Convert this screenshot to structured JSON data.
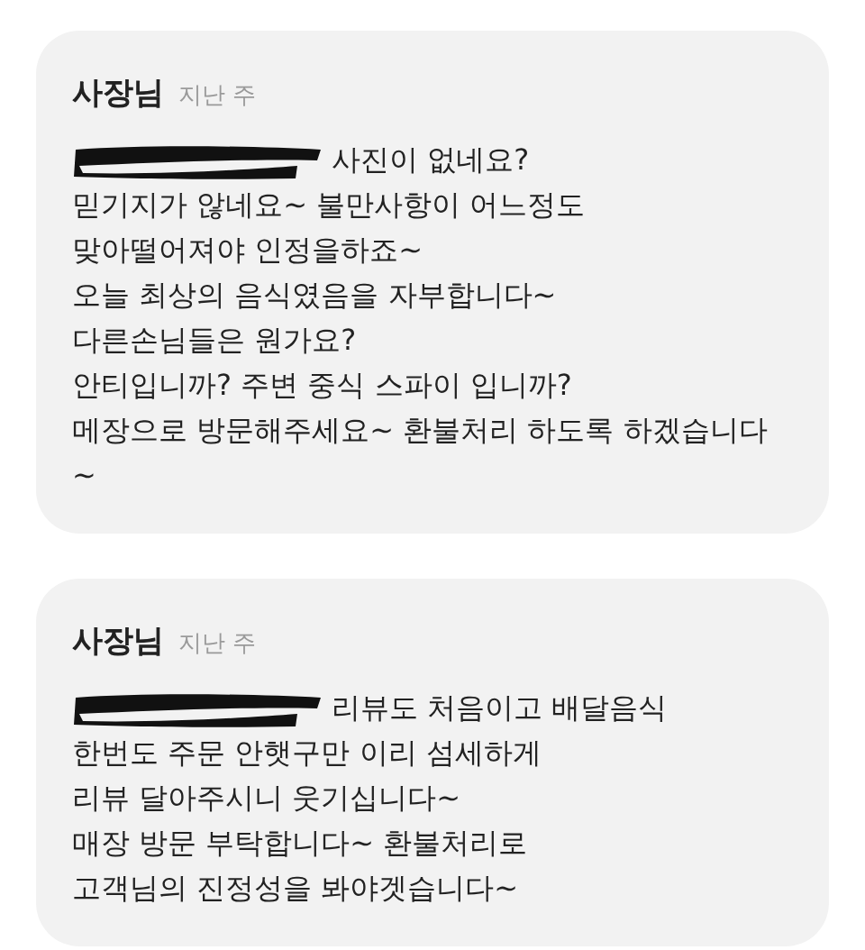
{
  "replies": [
    {
      "author": "사장님",
      "time": "지난 주",
      "redacted": true,
      "lines": [
        "사진이 없네요?",
        "믿기지가 않네요~ 불만사항이 어느정도",
        "맞아떨어져야 인정을하죠~",
        "오늘 최상의 음식였음을 자부합니다~",
        "다른손님들은 원가요?",
        "안티입니까? 주변 중식 스파이 입니까?",
        "메장으로 방문해주세요~ 환불처리 하도록 하겠습니다",
        "~"
      ]
    },
    {
      "author": "사장님",
      "time": "지난 주",
      "redacted": true,
      "lines": [
        "리뷰도 처음이고 배달음식",
        "한번도 주문 안햇구만 이리 섬세하게",
        "리뷰 달아주시니 웃기십니다~",
        "매장 방문 부탁합니다~ 환불처리로",
        "고객님의 진정성을 봐야겟습니다~"
      ]
    }
  ]
}
